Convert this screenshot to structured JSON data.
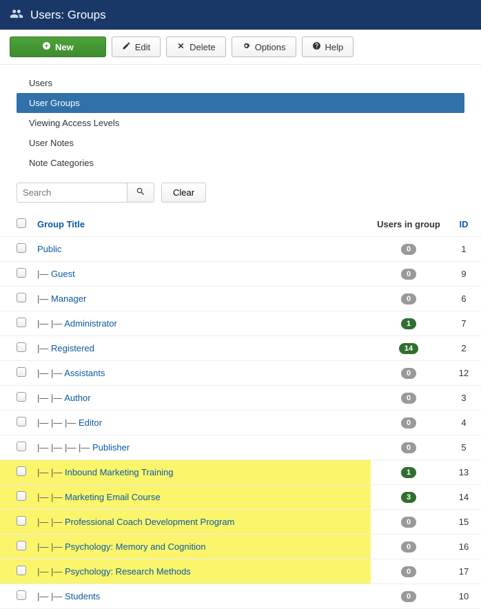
{
  "header": {
    "title": "Users: Groups"
  },
  "toolbar": {
    "new": "New",
    "edit": "Edit",
    "delete": "Delete",
    "options": "Options",
    "help": "Help"
  },
  "subnav": {
    "items": [
      {
        "label": "Users",
        "active": false
      },
      {
        "label": "User Groups",
        "active": true
      },
      {
        "label": "Viewing Access Levels",
        "active": false
      },
      {
        "label": "User Notes",
        "active": false
      },
      {
        "label": "Note Categories",
        "active": false
      }
    ]
  },
  "search": {
    "placeholder": "Search",
    "value": "",
    "clear": "Clear"
  },
  "table": {
    "headers": {
      "title": "Group Title",
      "users": "Users in group",
      "id": "ID"
    },
    "rows": [
      {
        "depth": 0,
        "title": "Public",
        "users": 0,
        "id": 1,
        "highlight": false
      },
      {
        "depth": 1,
        "title": "Guest",
        "users": 0,
        "id": 9,
        "highlight": false
      },
      {
        "depth": 1,
        "title": "Manager",
        "users": 0,
        "id": 6,
        "highlight": false
      },
      {
        "depth": 2,
        "title": "Administrator",
        "users": 1,
        "id": 7,
        "highlight": false
      },
      {
        "depth": 1,
        "title": "Registered",
        "users": 14,
        "id": 2,
        "highlight": false
      },
      {
        "depth": 2,
        "title": "Assistants",
        "users": 0,
        "id": 12,
        "highlight": false
      },
      {
        "depth": 2,
        "title": "Author",
        "users": 0,
        "id": 3,
        "highlight": false
      },
      {
        "depth": 3,
        "title": "Editor",
        "users": 0,
        "id": 4,
        "highlight": false
      },
      {
        "depth": 4,
        "title": "Publisher",
        "users": 0,
        "id": 5,
        "highlight": false
      },
      {
        "depth": 2,
        "title": "Inbound Marketing Training",
        "users": 1,
        "id": 13,
        "highlight": true
      },
      {
        "depth": 2,
        "title": "Marketing Email Course",
        "users": 3,
        "id": 14,
        "highlight": true
      },
      {
        "depth": 2,
        "title": "Professional Coach Development Program",
        "users": 0,
        "id": 15,
        "highlight": true
      },
      {
        "depth": 2,
        "title": "Psychology: Memory and Cognition",
        "users": 0,
        "id": 16,
        "highlight": true
      },
      {
        "depth": 2,
        "title": "Psychology: Research Methods",
        "users": 0,
        "id": 17,
        "highlight": true
      },
      {
        "depth": 2,
        "title": "Students",
        "users": 0,
        "id": 10,
        "highlight": false
      }
    ]
  }
}
